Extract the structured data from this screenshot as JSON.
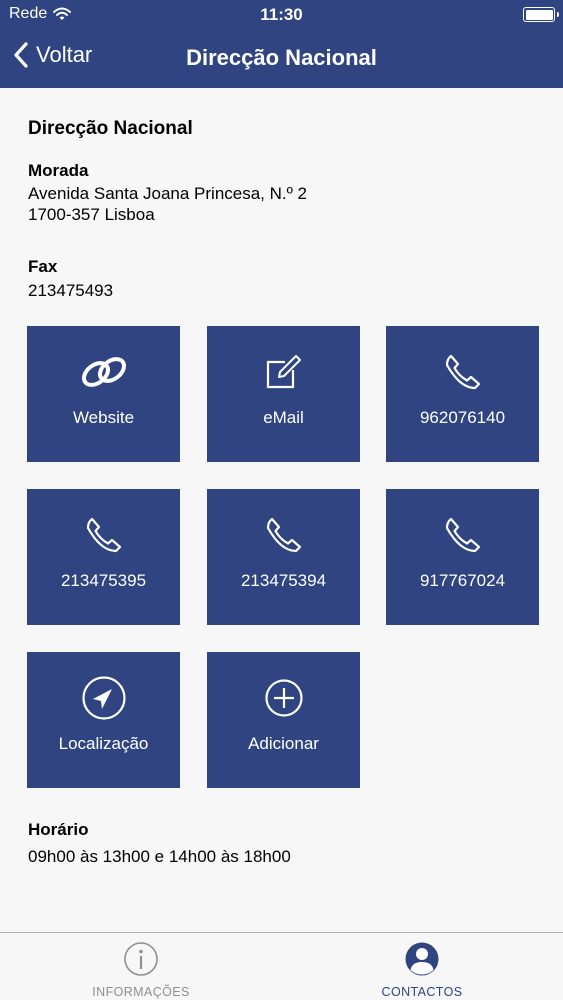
{
  "status_bar": {
    "carrier": "Rede",
    "time": "11:30"
  },
  "nav": {
    "back_label": "Voltar",
    "title": "Direcção Nacional"
  },
  "main": {
    "heading": "Direcção Nacional",
    "address_label": "Morada",
    "address_line1": "Avenida Santa Joana Princesa, N.º 2",
    "address_line2": "1700-357 Lisboa",
    "fax_label": "Fax",
    "fax_value": "213475493",
    "schedule_label": "Horário",
    "schedule_value": "09h00 às 13h00 e 14h00 às 18h00"
  },
  "tiles": [
    {
      "label": "Website",
      "icon": "link-icon"
    },
    {
      "label": "eMail",
      "icon": "compose-icon"
    },
    {
      "label": "962076140",
      "icon": "phone-icon"
    },
    {
      "label": "213475395",
      "icon": "phone-icon"
    },
    {
      "label": "213475394",
      "icon": "phone-icon"
    },
    {
      "label": "917767024",
      "icon": "phone-icon"
    },
    {
      "label": "Localização",
      "icon": "navigation-arrow-icon"
    },
    {
      "label": "Adicionar",
      "icon": "add-circle-icon"
    }
  ],
  "tabbar": {
    "tabs": [
      {
        "label": "INFORMAÇÕES",
        "icon": "info-icon",
        "selected": false
      },
      {
        "label": "CONTACTOS",
        "icon": "contact-person-icon",
        "selected": true
      }
    ]
  },
  "colors": {
    "brand": "#2f4480",
    "background": "#f7f7f7",
    "tab_inactive": "#8e8e93",
    "tab_active": "#2f4480"
  }
}
